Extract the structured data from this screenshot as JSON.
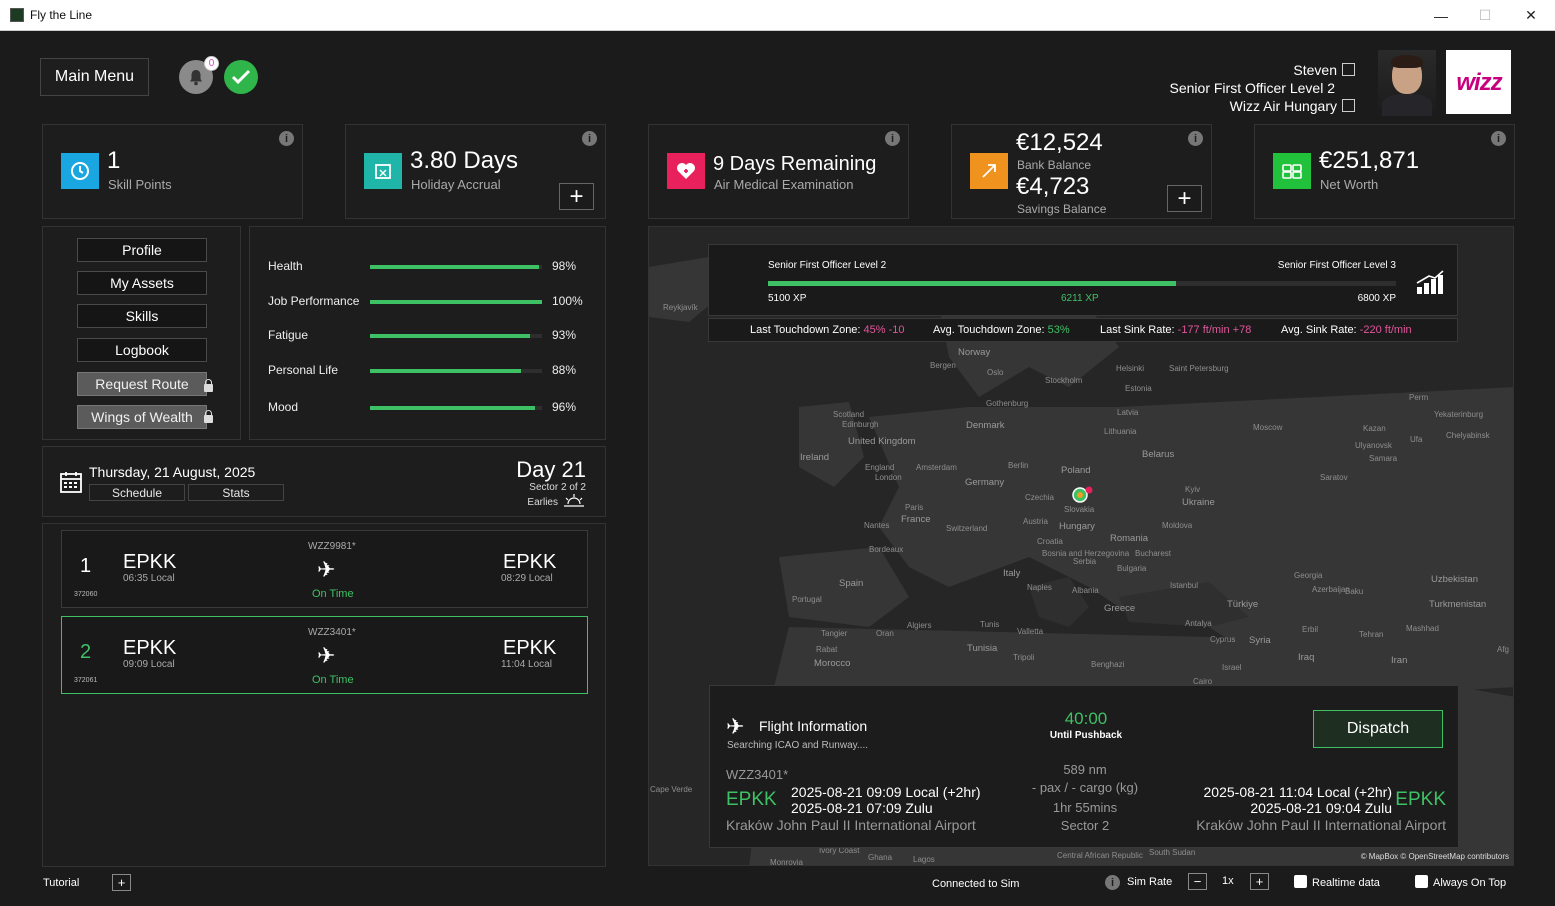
{
  "window": {
    "title": "Fly the Line",
    "minimize": "—",
    "maximize": "☐",
    "close": "✕"
  },
  "header": {
    "main_menu": "Main Menu",
    "notification_count": "0",
    "pilot_name": "Steven",
    "pilot_rank": "Senior First Officer Level 2",
    "airline": "Wizz Air Hungary",
    "airline_logo": "wizz"
  },
  "stats": {
    "skill_points": {
      "value": "1",
      "label": "Skill Points"
    },
    "holiday": {
      "value": "3.80 Days",
      "label": "Holiday Accrual"
    },
    "medical": {
      "value": "9 Days Remaining",
      "label": "Air Medical Examination"
    },
    "bank": {
      "value": "€12,524",
      "label": "Bank Balance",
      "savings_value": "€4,723",
      "savings_label": "Savings Balance"
    },
    "net_worth": {
      "value": "€251,871",
      "label": "Net Worth"
    }
  },
  "nav": {
    "profile": "Profile",
    "my_assets": "My Assets",
    "skills": "Skills",
    "logbook": "Logbook",
    "request_route": "Request Route",
    "wings_of_wealth": "Wings of Wealth"
  },
  "attributes": [
    {
      "label": "Health",
      "value": "98%",
      "level": 0.98
    },
    {
      "label": "Job Performance",
      "value": "100%",
      "level": 1.0
    },
    {
      "label": "Fatigue",
      "value": "93%",
      "level": 0.93
    },
    {
      "label": "Personal Life",
      "value": "88%",
      "level": 0.88
    },
    {
      "label": "Mood",
      "value": "96%",
      "level": 0.96
    }
  ],
  "schedule": {
    "date": "Thursday, 21 August, 2025",
    "tab_schedule": "Schedule",
    "tab_stats": "Stats",
    "day": "Day 21",
    "sector": "Sector 2 of 2",
    "shift": "Earlies"
  },
  "flights": [
    {
      "num": "1",
      "tail": "372060",
      "dep": "EPKK",
      "dep_time": "06:35 Local",
      "id": "WZZ9981*",
      "status": "On Time",
      "arr": "EPKK",
      "arr_time": "08:29 Local"
    },
    {
      "num": "2",
      "tail": "372061",
      "dep": "EPKK",
      "dep_time": "09:09 Local",
      "id": "WZZ3401*",
      "status": "On Time",
      "arr": "EPKK",
      "arr_time": "11:04 Local"
    }
  ],
  "progression": {
    "current_rank": "Senior First Officer Level 2",
    "next_rank": "Senior First Officer Level 3",
    "min_xp": "5100 XP",
    "current_xp": "6211 XP",
    "max_xp": "6800 XP",
    "progress": 0.65,
    "last_touchdown_label": "Last Touchdown Zone:",
    "last_touchdown_value": "45% -10",
    "avg_touchdown_label": "Avg. Touchdown Zone:",
    "avg_touchdown_value": "53%",
    "last_sink_label": "Last Sink Rate:",
    "last_sink_value": "-177 ft/min +78",
    "avg_sink_label": "Avg. Sink Rate:",
    "avg_sink_value": "-220 ft/min"
  },
  "map_labels": [
    "Reykjavík",
    "Norway",
    "Oslo",
    "Helsinki",
    "Saint Petersburg",
    "Bergen",
    "Stockholm",
    "Estonia",
    "Perm",
    "Gothenburg",
    "Latvia",
    "Yekaterinburg",
    "Scotland",
    "Edinburgh",
    "Denmark",
    "Lithuania",
    "Moscow",
    "Kazan",
    "Ufa",
    "Chelyabinsk",
    "United Kingdom",
    "Ulyanovsk",
    "Ireland",
    "England",
    "Amsterdam",
    "Berlin",
    "Belarus",
    "Samara",
    "London",
    "Poland",
    "Germany",
    "Saratov",
    "Kyiv",
    "Paris",
    "Czechia",
    "Ukraine",
    "France",
    "Slovakia",
    "Austria",
    "Nantes",
    "Switzerland",
    "Hungary",
    "Moldova",
    "Croatia",
    "Bordeaux",
    "Bosnia and Herzegovina",
    "Romania",
    "Bucharest",
    "Serbia",
    "Bulgaria",
    "Spain",
    "Italy",
    "Georgia",
    "Uzbekistan",
    "Istanbul",
    "Portugal",
    "Naples",
    "Albania",
    "Azerbaijan",
    "Baku",
    "Greece",
    "Türkiye",
    "Turkmenistan",
    "Tangier",
    "Oran",
    "Algiers",
    "Tunis",
    "Valletta",
    "Antalya",
    "Erbil",
    "Mashhad",
    "Rabat",
    "Tunisia",
    "Cyprus",
    "Syria",
    "Tehran",
    "Morocco",
    "Tripoli",
    "Iraq",
    "Afg",
    "Benghazi",
    "Israel",
    "Iran",
    "Cairo",
    "Cape Verde",
    "Ivory Coast",
    "Ghana",
    "Lagos",
    "Central African Republic",
    "South Sudan",
    "Monrovia"
  ],
  "map_attribution": "© MapBox © OpenStreetMap contributors",
  "flight_info": {
    "title": "Flight Information",
    "subtitle": "Searching ICAO and Runway....",
    "countdown": "40:00",
    "countdown_label": "Until Pushback",
    "dispatch": "Dispatch",
    "flight_id": "WZZ3401*",
    "dep_icao": "EPKK",
    "dep_local": "2025-08-21 09:09 Local (+2hr)",
    "dep_zulu": "2025-08-21 07:09 Zulu",
    "dep_airport": "Kraków John Paul II International Airport",
    "distance": "589 nm",
    "payload": "- pax / - cargo (kg)",
    "duration": "1hr 55mins",
    "sector": "Sector 2",
    "arr_icao": "EPKK",
    "arr_local": "2025-08-21 11:04 Local (+2hr)",
    "arr_zulu": "2025-08-21 09:04 Zulu",
    "arr_airport": "Kraków John Paul II International Airport"
  },
  "footer": {
    "tutorial": "Tutorial",
    "connection": "Connected to Sim",
    "sim_rate_label": "Sim Rate",
    "sim_rate_value": "1x",
    "realtime": "Realtime data",
    "always_on_top": "Always On Top"
  },
  "colors": {
    "accent_green": "#3ec165",
    "pink": "#e0559b",
    "skill_icon": "#1aa6e0",
    "holiday_icon": "#1fb5a8",
    "medical_icon": "#e8205c",
    "bank_icon": "#f0921e",
    "networth_icon": "#21c13b"
  }
}
